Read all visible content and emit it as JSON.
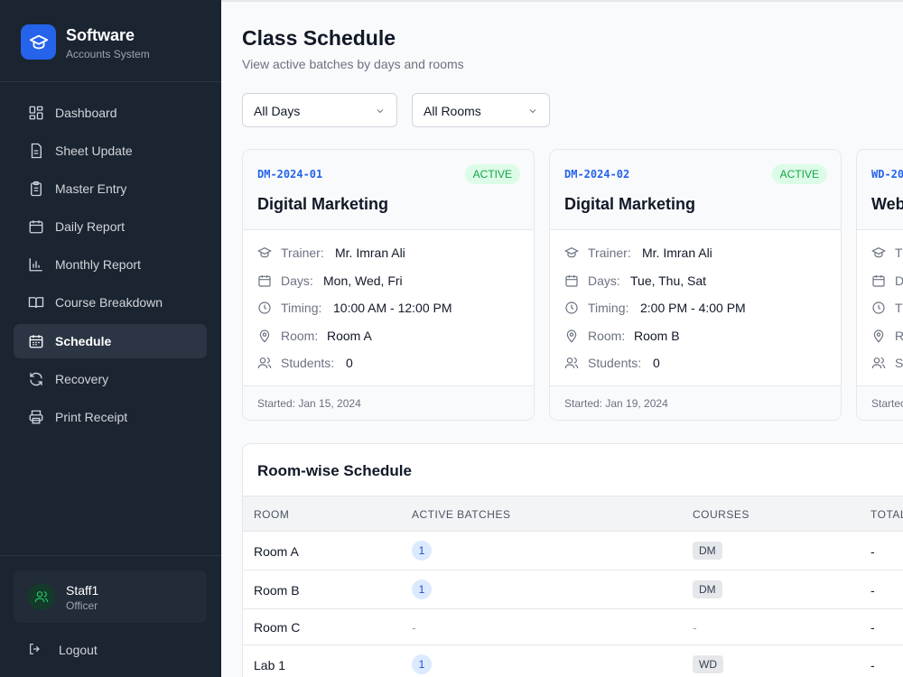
{
  "brand": {
    "title": "Software",
    "subtitle": "Accounts System"
  },
  "sidebar": {
    "items": [
      {
        "label": "Dashboard",
        "icon": "dashboard-grid-icon",
        "active": false
      },
      {
        "label": "Sheet Update",
        "icon": "document-sheet-icon",
        "active": false
      },
      {
        "label": "Master Entry",
        "icon": "clipboard-icon",
        "active": false
      },
      {
        "label": "Daily Report",
        "icon": "calendar-icon",
        "active": false
      },
      {
        "label": "Monthly Report",
        "icon": "bar-chart-icon",
        "active": false
      },
      {
        "label": "Course Breakdown",
        "icon": "open-book-icon",
        "active": false
      },
      {
        "label": "Schedule",
        "icon": "calendar-days-icon",
        "active": true
      },
      {
        "label": "Recovery",
        "icon": "refresh-icon",
        "active": false
      },
      {
        "label": "Print Receipt",
        "icon": "printer-icon",
        "active": false
      }
    ]
  },
  "user": {
    "name": "Staff1",
    "role": "Officer"
  },
  "logout_label": "Logout",
  "page": {
    "title": "Class Schedule",
    "subtitle": "View active batches by days and rooms"
  },
  "filters": {
    "days": "All Days",
    "rooms": "All Rooms"
  },
  "labels": {
    "trainer": "Trainer:",
    "days": "Days:",
    "timing": "Timing:",
    "room": "Room:",
    "students": "Students:"
  },
  "batches": [
    {
      "code": "DM-2024-01",
      "status": "ACTIVE",
      "course": "Digital Marketing",
      "trainer": "Mr. Imran Ali",
      "days": "Mon, Wed, Fri",
      "timing": "10:00 AM - 12:00 PM",
      "room": "Room A",
      "students": "0",
      "started": "Started: Jan 15, 2024"
    },
    {
      "code": "DM-2024-02",
      "status": "ACTIVE",
      "course": "Digital Marketing",
      "trainer": "Mr. Imran Ali",
      "days": "Tue, Thu, Sat",
      "timing": "2:00 PM - 4:00 PM",
      "room": "Room B",
      "students": "0",
      "started": "Started: Jan 19, 2024"
    },
    {
      "code": "WD-20",
      "status": "",
      "course": "Web",
      "trainer": "",
      "days": "",
      "timing": "",
      "room": "",
      "students": "",
      "started": "Startec"
    }
  ],
  "partial_labels": {
    "trainer": "T",
    "days": "D",
    "timing": "T",
    "room": "R",
    "students": "S"
  },
  "room_schedule": {
    "title": "Room-wise Schedule",
    "columns": [
      "ROOM",
      "ACTIVE BATCHES",
      "COURSES",
      "TOTAL"
    ],
    "rows": [
      {
        "room": "Room A",
        "batches": "1",
        "course": "DM",
        "total": "-"
      },
      {
        "room": "Room B",
        "batches": "1",
        "course": "DM",
        "total": "-"
      },
      {
        "room": "Room C",
        "batches": "-",
        "course": "-",
        "total": "-"
      },
      {
        "room": "Lab 1",
        "batches": "1",
        "course": "WD",
        "total": "-"
      }
    ]
  },
  "colors": {
    "sidebar_bg": "#1b2431",
    "accent": "#2563eb",
    "active_green": "#16a34a"
  }
}
